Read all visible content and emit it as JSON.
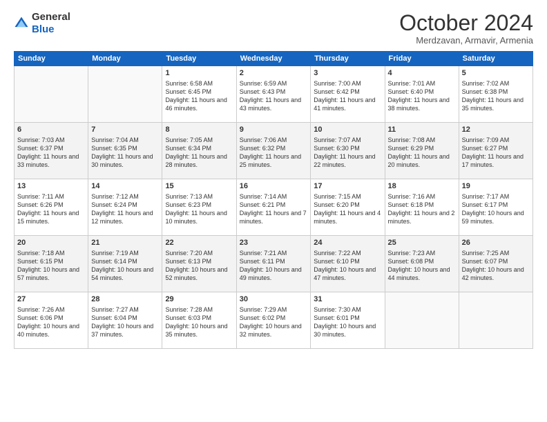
{
  "logo": {
    "general": "General",
    "blue": "Blue"
  },
  "header": {
    "month": "October 2024",
    "location": "Merdzavan, Armavir, Armenia"
  },
  "weekdays": [
    "Sunday",
    "Monday",
    "Tuesday",
    "Wednesday",
    "Thursday",
    "Friday",
    "Saturday"
  ],
  "weeks": [
    [
      {
        "day": "",
        "sunrise": "",
        "sunset": "",
        "daylight": ""
      },
      {
        "day": "",
        "sunrise": "",
        "sunset": "",
        "daylight": ""
      },
      {
        "day": "1",
        "sunrise": "Sunrise: 6:58 AM",
        "sunset": "Sunset: 6:45 PM",
        "daylight": "Daylight: 11 hours and 46 minutes."
      },
      {
        "day": "2",
        "sunrise": "Sunrise: 6:59 AM",
        "sunset": "Sunset: 6:43 PM",
        "daylight": "Daylight: 11 hours and 43 minutes."
      },
      {
        "day": "3",
        "sunrise": "Sunrise: 7:00 AM",
        "sunset": "Sunset: 6:42 PM",
        "daylight": "Daylight: 11 hours and 41 minutes."
      },
      {
        "day": "4",
        "sunrise": "Sunrise: 7:01 AM",
        "sunset": "Sunset: 6:40 PM",
        "daylight": "Daylight: 11 hours and 38 minutes."
      },
      {
        "day": "5",
        "sunrise": "Sunrise: 7:02 AM",
        "sunset": "Sunset: 6:38 PM",
        "daylight": "Daylight: 11 hours and 35 minutes."
      }
    ],
    [
      {
        "day": "6",
        "sunrise": "Sunrise: 7:03 AM",
        "sunset": "Sunset: 6:37 PM",
        "daylight": "Daylight: 11 hours and 33 minutes."
      },
      {
        "day": "7",
        "sunrise": "Sunrise: 7:04 AM",
        "sunset": "Sunset: 6:35 PM",
        "daylight": "Daylight: 11 hours and 30 minutes."
      },
      {
        "day": "8",
        "sunrise": "Sunrise: 7:05 AM",
        "sunset": "Sunset: 6:34 PM",
        "daylight": "Daylight: 11 hours and 28 minutes."
      },
      {
        "day": "9",
        "sunrise": "Sunrise: 7:06 AM",
        "sunset": "Sunset: 6:32 PM",
        "daylight": "Daylight: 11 hours and 25 minutes."
      },
      {
        "day": "10",
        "sunrise": "Sunrise: 7:07 AM",
        "sunset": "Sunset: 6:30 PM",
        "daylight": "Daylight: 11 hours and 22 minutes."
      },
      {
        "day": "11",
        "sunrise": "Sunrise: 7:08 AM",
        "sunset": "Sunset: 6:29 PM",
        "daylight": "Daylight: 11 hours and 20 minutes."
      },
      {
        "day": "12",
        "sunrise": "Sunrise: 7:09 AM",
        "sunset": "Sunset: 6:27 PM",
        "daylight": "Daylight: 11 hours and 17 minutes."
      }
    ],
    [
      {
        "day": "13",
        "sunrise": "Sunrise: 7:11 AM",
        "sunset": "Sunset: 6:26 PM",
        "daylight": "Daylight: 11 hours and 15 minutes."
      },
      {
        "day": "14",
        "sunrise": "Sunrise: 7:12 AM",
        "sunset": "Sunset: 6:24 PM",
        "daylight": "Daylight: 11 hours and 12 minutes."
      },
      {
        "day": "15",
        "sunrise": "Sunrise: 7:13 AM",
        "sunset": "Sunset: 6:23 PM",
        "daylight": "Daylight: 11 hours and 10 minutes."
      },
      {
        "day": "16",
        "sunrise": "Sunrise: 7:14 AM",
        "sunset": "Sunset: 6:21 PM",
        "daylight": "Daylight: 11 hours and 7 minutes."
      },
      {
        "day": "17",
        "sunrise": "Sunrise: 7:15 AM",
        "sunset": "Sunset: 6:20 PM",
        "daylight": "Daylight: 11 hours and 4 minutes."
      },
      {
        "day": "18",
        "sunrise": "Sunrise: 7:16 AM",
        "sunset": "Sunset: 6:18 PM",
        "daylight": "Daylight: 11 hours and 2 minutes."
      },
      {
        "day": "19",
        "sunrise": "Sunrise: 7:17 AM",
        "sunset": "Sunset: 6:17 PM",
        "daylight": "Daylight: 10 hours and 59 minutes."
      }
    ],
    [
      {
        "day": "20",
        "sunrise": "Sunrise: 7:18 AM",
        "sunset": "Sunset: 6:15 PM",
        "daylight": "Daylight: 10 hours and 57 minutes."
      },
      {
        "day": "21",
        "sunrise": "Sunrise: 7:19 AM",
        "sunset": "Sunset: 6:14 PM",
        "daylight": "Daylight: 10 hours and 54 minutes."
      },
      {
        "day": "22",
        "sunrise": "Sunrise: 7:20 AM",
        "sunset": "Sunset: 6:13 PM",
        "daylight": "Daylight: 10 hours and 52 minutes."
      },
      {
        "day": "23",
        "sunrise": "Sunrise: 7:21 AM",
        "sunset": "Sunset: 6:11 PM",
        "daylight": "Daylight: 10 hours and 49 minutes."
      },
      {
        "day": "24",
        "sunrise": "Sunrise: 7:22 AM",
        "sunset": "Sunset: 6:10 PM",
        "daylight": "Daylight: 10 hours and 47 minutes."
      },
      {
        "day": "25",
        "sunrise": "Sunrise: 7:23 AM",
        "sunset": "Sunset: 6:08 PM",
        "daylight": "Daylight: 10 hours and 44 minutes."
      },
      {
        "day": "26",
        "sunrise": "Sunrise: 7:25 AM",
        "sunset": "Sunset: 6:07 PM",
        "daylight": "Daylight: 10 hours and 42 minutes."
      }
    ],
    [
      {
        "day": "27",
        "sunrise": "Sunrise: 7:26 AM",
        "sunset": "Sunset: 6:06 PM",
        "daylight": "Daylight: 10 hours and 40 minutes."
      },
      {
        "day": "28",
        "sunrise": "Sunrise: 7:27 AM",
        "sunset": "Sunset: 6:04 PM",
        "daylight": "Daylight: 10 hours and 37 minutes."
      },
      {
        "day": "29",
        "sunrise": "Sunrise: 7:28 AM",
        "sunset": "Sunset: 6:03 PM",
        "daylight": "Daylight: 10 hours and 35 minutes."
      },
      {
        "day": "30",
        "sunrise": "Sunrise: 7:29 AM",
        "sunset": "Sunset: 6:02 PM",
        "daylight": "Daylight: 10 hours and 32 minutes."
      },
      {
        "day": "31",
        "sunrise": "Sunrise: 7:30 AM",
        "sunset": "Sunset: 6:01 PM",
        "daylight": "Daylight: 10 hours and 30 minutes."
      },
      {
        "day": "",
        "sunrise": "",
        "sunset": "",
        "daylight": ""
      },
      {
        "day": "",
        "sunrise": "",
        "sunset": "",
        "daylight": ""
      }
    ]
  ]
}
